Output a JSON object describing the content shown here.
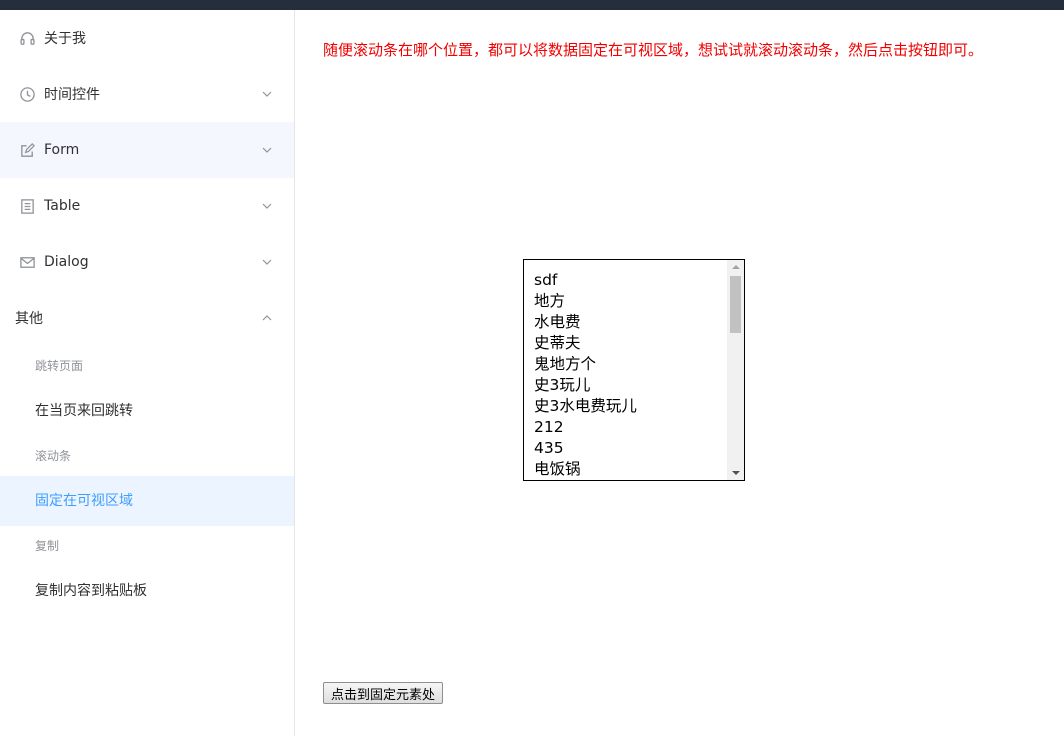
{
  "sidebar": {
    "items": [
      {
        "label": "关于我",
        "icon": "headset-icon",
        "expandable": false
      },
      {
        "label": "时间控件",
        "icon": "clock-icon",
        "expandable": true
      },
      {
        "label": "Form",
        "icon": "edit-icon",
        "expandable": true
      },
      {
        "label": "Table",
        "icon": "document-icon",
        "expandable": true
      },
      {
        "label": "Dialog",
        "icon": "message-icon",
        "expandable": true
      }
    ],
    "other": {
      "label": "其他",
      "groups": [
        {
          "title": "跳转页面",
          "items": [
            "在当页来回跳转"
          ]
        },
        {
          "title": "滚动条",
          "items": [
            "固定在可视区域"
          ]
        },
        {
          "title": "复制",
          "items": [
            "复制内容到粘贴板"
          ]
        }
      ]
    }
  },
  "main": {
    "notice": "随便滚动条在哪个位置，都可以将数据固定在可视区域，想试试就滚动滚动条，然后点击按钮即可。",
    "list_items": [
      "sdf",
      "地方",
      "水电费",
      "史蒂夫",
      "鬼地方个",
      "史3玩儿",
      "史3水电费玩儿",
      "212",
      "435",
      "电饭锅"
    ],
    "button_label": "点击到固定元素处"
  },
  "colors": {
    "topbar": "#242f3b",
    "active": "#409eff",
    "active_bg": "#ecf5ff",
    "notice": "#f00000"
  }
}
